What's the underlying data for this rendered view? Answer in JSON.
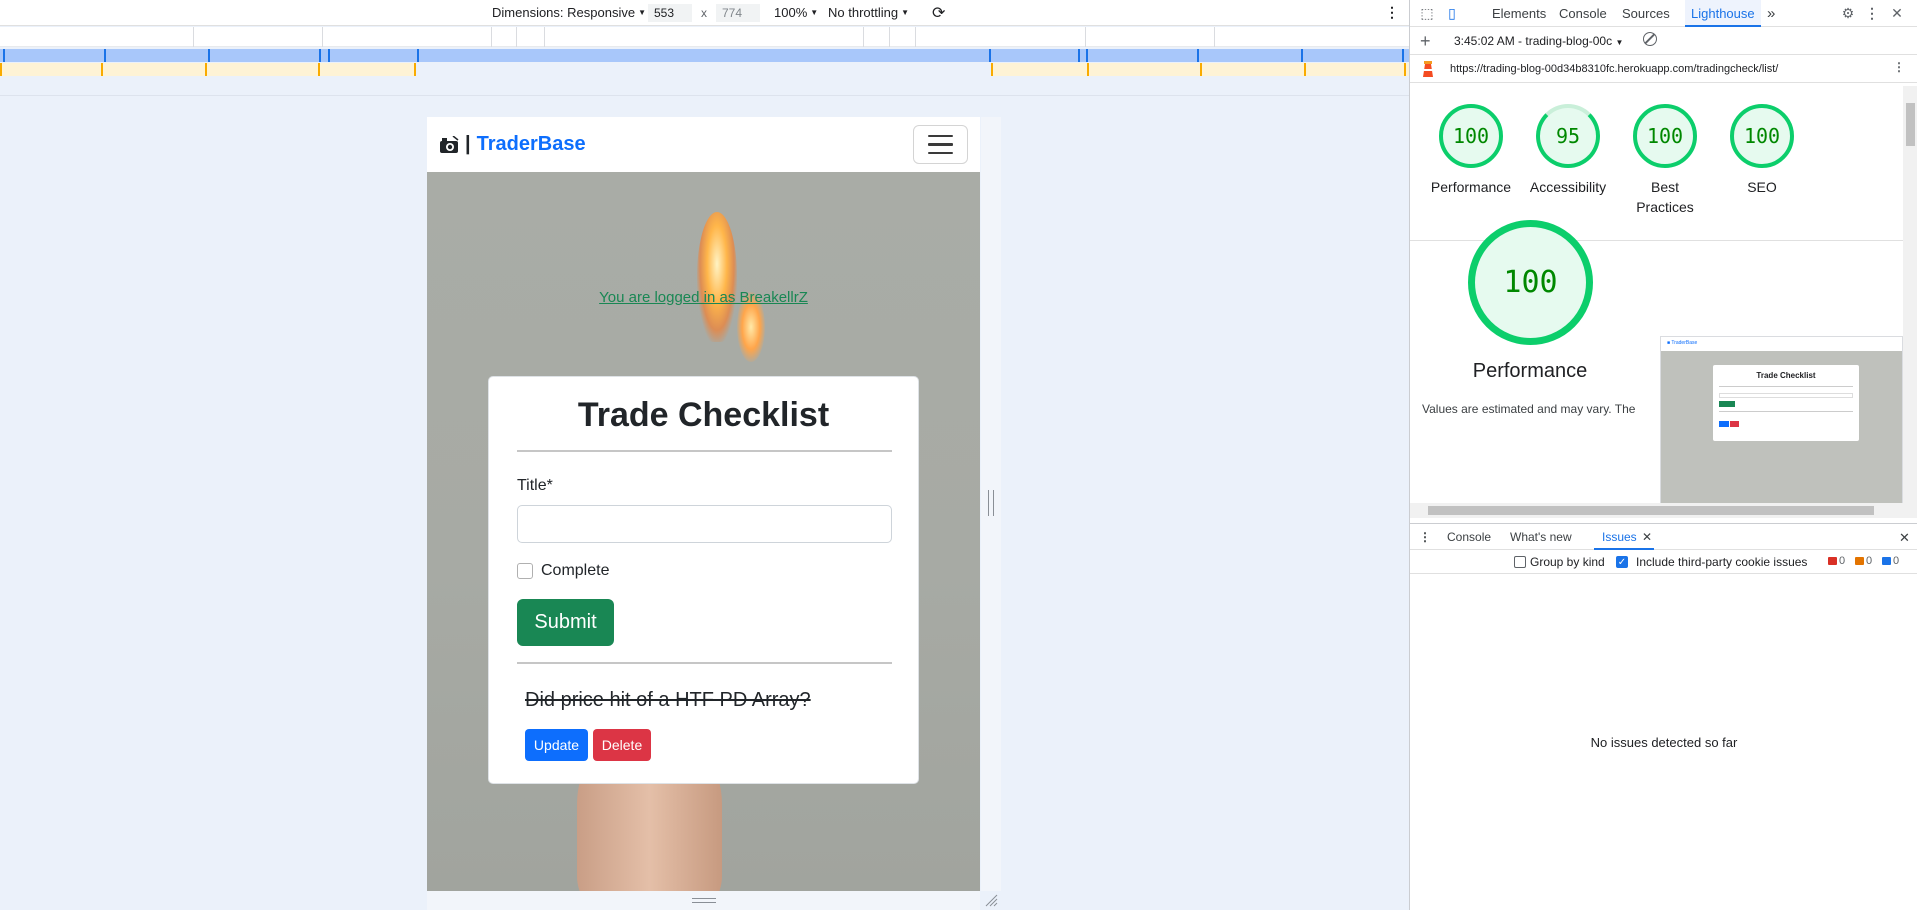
{
  "device_toolbar": {
    "dimensions_label": "Dimensions: Responsive",
    "width": "553",
    "height": "774",
    "times": "x",
    "zoom": "100%",
    "throttling": "No throttling",
    "more_icon": "vertical-dots-icon",
    "rotate_icon": "rotate-icon"
  },
  "page": {
    "brand_icon": "camera-retro-icon",
    "brand_separator": "|",
    "brand_name": "TraderBase",
    "logged_in_text": "You are logged in as BreakellrZ",
    "card_title": "Trade Checklist",
    "title_label": "Title*",
    "title_value": "",
    "complete_label": "Complete",
    "submit_label": "Submit",
    "item_text": "Did price hit of a HTF PD Array?",
    "update_label": "Update",
    "delete_label": "Delete",
    "colors": {
      "brand": "#0d6efd",
      "submit": "#198754",
      "update": "#0d6efd",
      "delete": "#dc3545"
    }
  },
  "devtools": {
    "tabs": [
      "Elements",
      "Console",
      "Sources",
      "Lighthouse"
    ],
    "active_tab": "Lighthouse",
    "more_tabs": "»",
    "report_selector": "3:45:02 AM - trading-blog-00c",
    "url": "https://trading-blog-00d34b8310fc.herokuapp.com/tradingcheck/list/",
    "scores": [
      {
        "label": "Performance",
        "value": "100"
      },
      {
        "label": "Accessibility",
        "value": "95"
      },
      {
        "label": "Best Practices",
        "value": "100"
      },
      {
        "label": "SEO",
        "value": "100"
      }
    ],
    "big_score": "100",
    "big_label": "Performance",
    "big_note": "Values are estimated and may vary. The",
    "thumb_title": "Trade Checklist",
    "drawer_tabs": [
      "Console",
      "What's new",
      "Issues"
    ],
    "active_drawer_tab": "Issues",
    "group_by_kind": "Group by kind",
    "include_third_party": "Include third-party cookie issues",
    "errors": "0",
    "warnings": "0",
    "infos": "0",
    "no_issues": "No issues detected so far"
  }
}
